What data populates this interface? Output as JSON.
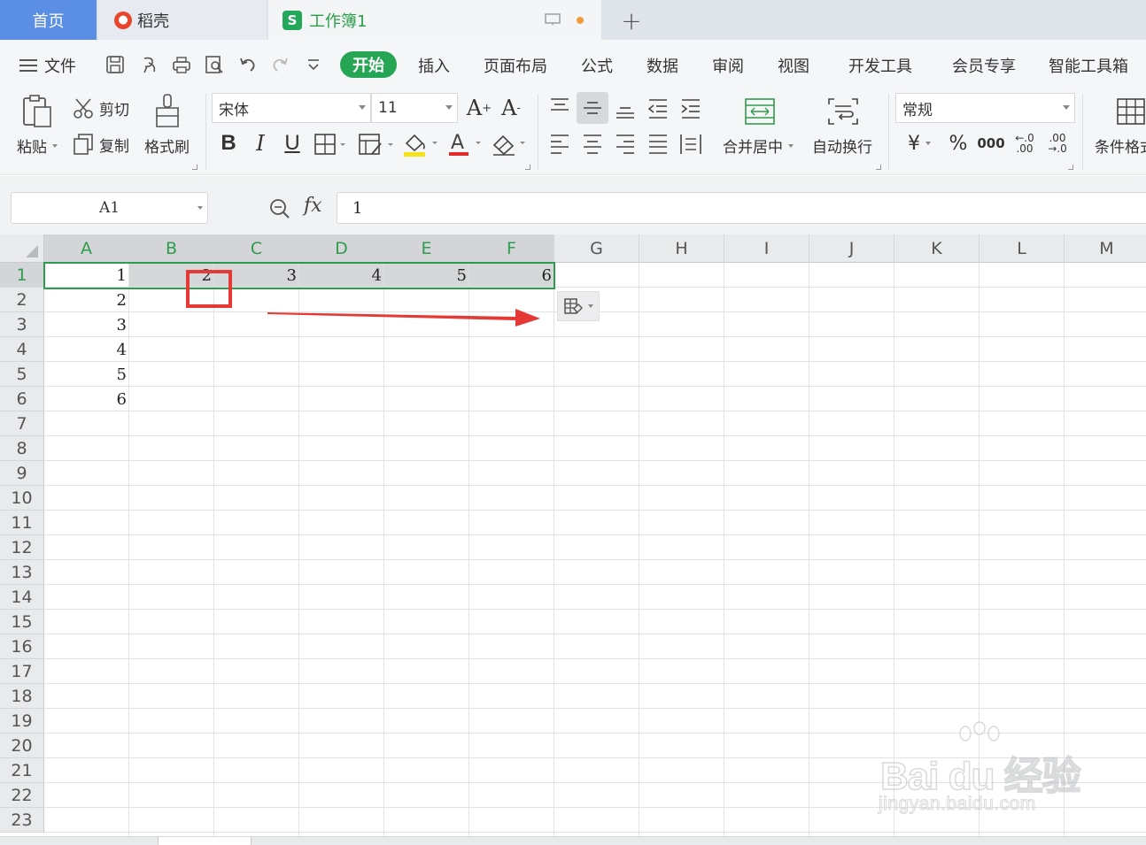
{
  "tabs": {
    "home": "首页",
    "daoke": "稻壳",
    "workbook": "工作簿1"
  },
  "menu": {
    "file": "文件",
    "items": [
      "开始",
      "插入",
      "页面布局",
      "公式",
      "数据",
      "审阅",
      "视图",
      "开发工具",
      "会员专享",
      "智能工具箱"
    ]
  },
  "ribbon": {
    "paste": "粘贴",
    "cut": "剪切",
    "copy": "复制",
    "format_painter": "格式刷",
    "font_name": "宋体",
    "font_size": "11",
    "merge_center": "合并居中",
    "wrap_text": "自动换行",
    "number_format": "常规",
    "conditional_format": "条件格式"
  },
  "formula_bar": {
    "name_box": "A1",
    "fx": "fx",
    "value": "1"
  },
  "columns": [
    "A",
    "B",
    "C",
    "D",
    "E",
    "F",
    "G",
    "H",
    "I",
    "J",
    "K",
    "L",
    "M"
  ],
  "rows": [
    "1",
    "2",
    "3",
    "4",
    "5",
    "6",
    "7",
    "8",
    "9",
    "10",
    "11",
    "12",
    "13",
    "14",
    "15",
    "16",
    "17",
    "18",
    "19",
    "20",
    "21",
    "22",
    "23"
  ],
  "cells": {
    "row1": [
      "1",
      "2",
      "3",
      "4",
      "5",
      "6"
    ],
    "colA": [
      "2",
      "3",
      "4",
      "5",
      "6"
    ]
  },
  "watermark": {
    "brand": "Bai du 经验",
    "url": "jingyan.baidu.com"
  },
  "colors": {
    "accent_green": "#26a655",
    "selection_green": "#2e9b4d",
    "home_tab_blue": "#5b8fe6",
    "annotation_red": "#e53935"
  }
}
